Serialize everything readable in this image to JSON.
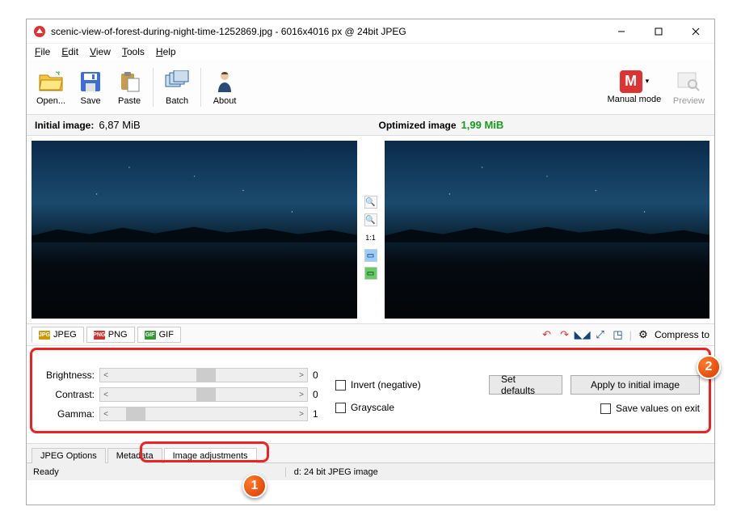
{
  "title": "scenic-view-of-forest-during-night-time-1252869.jpg - 6016x4016 px @ 24bit JPEG",
  "menu": {
    "file": "File",
    "edit": "Edit",
    "view": "View",
    "tools": "Tools",
    "help": "Help"
  },
  "toolbar": {
    "open": "Open...",
    "save": "Save",
    "paste": "Paste",
    "batch": "Batch",
    "about": "About",
    "manual": "Manual mode",
    "preview": "Preview"
  },
  "info": {
    "initial_label": "Initial image:",
    "initial_size": "6,87 MiB",
    "optimized_label": "Optimized image",
    "optimized_size": "1,99 MiB"
  },
  "midtools": {
    "ratio": "1:1"
  },
  "fmt": {
    "jpeg": "JPEG",
    "png": "PNG",
    "gif": "GIF"
  },
  "right": {
    "compress": "Compress to"
  },
  "adjust": {
    "brightness_label": "Brightness:",
    "brightness_val": "0",
    "contrast_label": "Contrast:",
    "contrast_val": "0",
    "gamma_label": "Gamma:",
    "gamma_val": "1",
    "invert": "Invert (negative)",
    "grayscale": "Grayscale",
    "setdef": "Set defaults",
    "apply": "Apply to initial image",
    "saveexit": "Save values on exit"
  },
  "tabs": {
    "opts": "JPEG Options",
    "meta": "Metadata",
    "adj": "Image adjustments"
  },
  "status": {
    "ready": "Ready",
    "info": "d: 24 bit JPEG image"
  },
  "badges": {
    "b1": "1",
    "b2": "2"
  }
}
